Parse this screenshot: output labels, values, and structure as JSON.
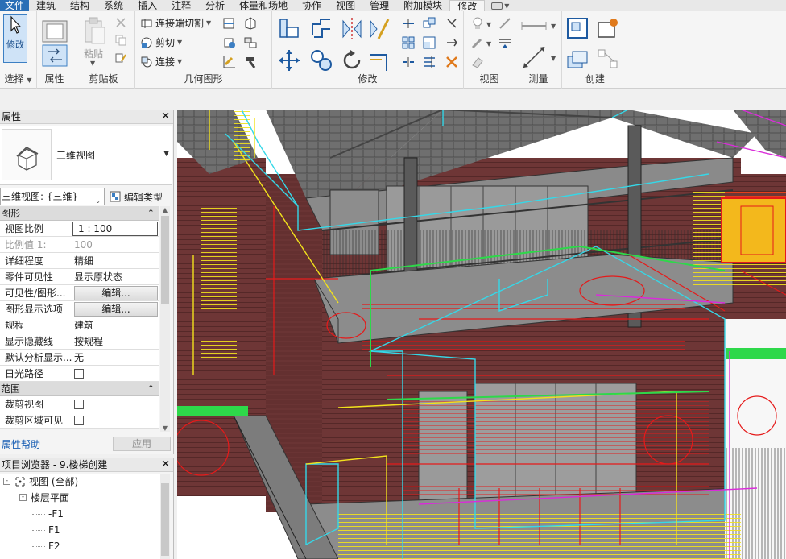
{
  "menu": {
    "tabs": [
      {
        "label": "文件",
        "state": "file"
      },
      {
        "label": "建筑",
        "state": ""
      },
      {
        "label": "结构",
        "state": ""
      },
      {
        "label": "系统",
        "state": ""
      },
      {
        "label": "插入",
        "state": ""
      },
      {
        "label": "注释",
        "state": ""
      },
      {
        "label": "分析",
        "state": ""
      },
      {
        "label": "体量和场地",
        "state": ""
      },
      {
        "label": "协作",
        "state": ""
      },
      {
        "label": "视图",
        "state": ""
      },
      {
        "label": "管理",
        "state": ""
      },
      {
        "label": "附加模块",
        "state": ""
      },
      {
        "label": "修改",
        "state": "active"
      }
    ]
  },
  "ribbon": {
    "select": {
      "modify_label": "修改",
      "panel_title": "选择"
    },
    "properties": {
      "panel_title": "属性"
    },
    "clipboard": {
      "paste_label": "粘贴",
      "panel_title": "剪贴板"
    },
    "geometry": {
      "cope_label": "连接端切割",
      "cut_label": "剪切",
      "join_label": "连接",
      "panel_title": "几何图形"
    },
    "modify": {
      "panel_title": "修改"
    },
    "view": {
      "panel_title": "视图"
    },
    "measure": {
      "panel_title": "测量"
    },
    "create": {
      "panel_title": "创建"
    }
  },
  "properties_palette": {
    "title": "属性",
    "type_name": "三维视图",
    "instance_selector": "三维视图: {三维}",
    "edit_type_label": "编辑类型",
    "groups": [
      {
        "name": "图形",
        "rows": [
          {
            "key": "视图比例",
            "value": "1 : 100",
            "kind": "input"
          },
          {
            "key": "比例值 1:",
            "value": "100",
            "kind": "dim"
          },
          {
            "key": "详细程度",
            "value": "精细",
            "kind": "text"
          },
          {
            "key": "零件可见性",
            "value": "显示原状态",
            "kind": "text"
          },
          {
            "key": "可见性/图形...",
            "value": "编辑...",
            "kind": "button"
          },
          {
            "key": "图形显示选项",
            "value": "编辑...",
            "kind": "button"
          },
          {
            "key": "规程",
            "value": "建筑",
            "kind": "text"
          },
          {
            "key": "显示隐藏线",
            "value": "按规程",
            "kind": "text"
          },
          {
            "key": "默认分析显示...",
            "value": "无",
            "kind": "text"
          },
          {
            "key": "日光路径",
            "value": "",
            "kind": "checkbox"
          }
        ]
      },
      {
        "name": "范围",
        "rows": [
          {
            "key": "裁剪视图",
            "value": "",
            "kind": "checkbox"
          },
          {
            "key": "裁剪区域可见",
            "value": "",
            "kind": "checkbox"
          }
        ]
      }
    ],
    "help_link": "属性帮助",
    "apply_label": "应用"
  },
  "project_browser": {
    "title": "项目浏览器 - 9.楼梯创建",
    "nodes": [
      {
        "label": "视图 (全部)",
        "level": 0,
        "toggle": "-"
      },
      {
        "label": "楼层平面",
        "level": 1,
        "toggle": "-"
      },
      {
        "label": "-F1",
        "level": 2,
        "toggle": ""
      },
      {
        "label": "F1",
        "level": 2,
        "toggle": ""
      },
      {
        "label": "F2",
        "level": 2,
        "toggle": ""
      }
    ]
  },
  "colors": {
    "file_tab": "#2a6fb6",
    "selection_blue": "#3c7fc3",
    "brick": "#6e3636",
    "roof": "#6b6b6b",
    "cyan_line": "#35d8e8",
    "red_line": "#e51a1a",
    "yellow_line": "#f2e21c",
    "green_line": "#2ed84a",
    "magenta_line": "#d92cd9"
  }
}
